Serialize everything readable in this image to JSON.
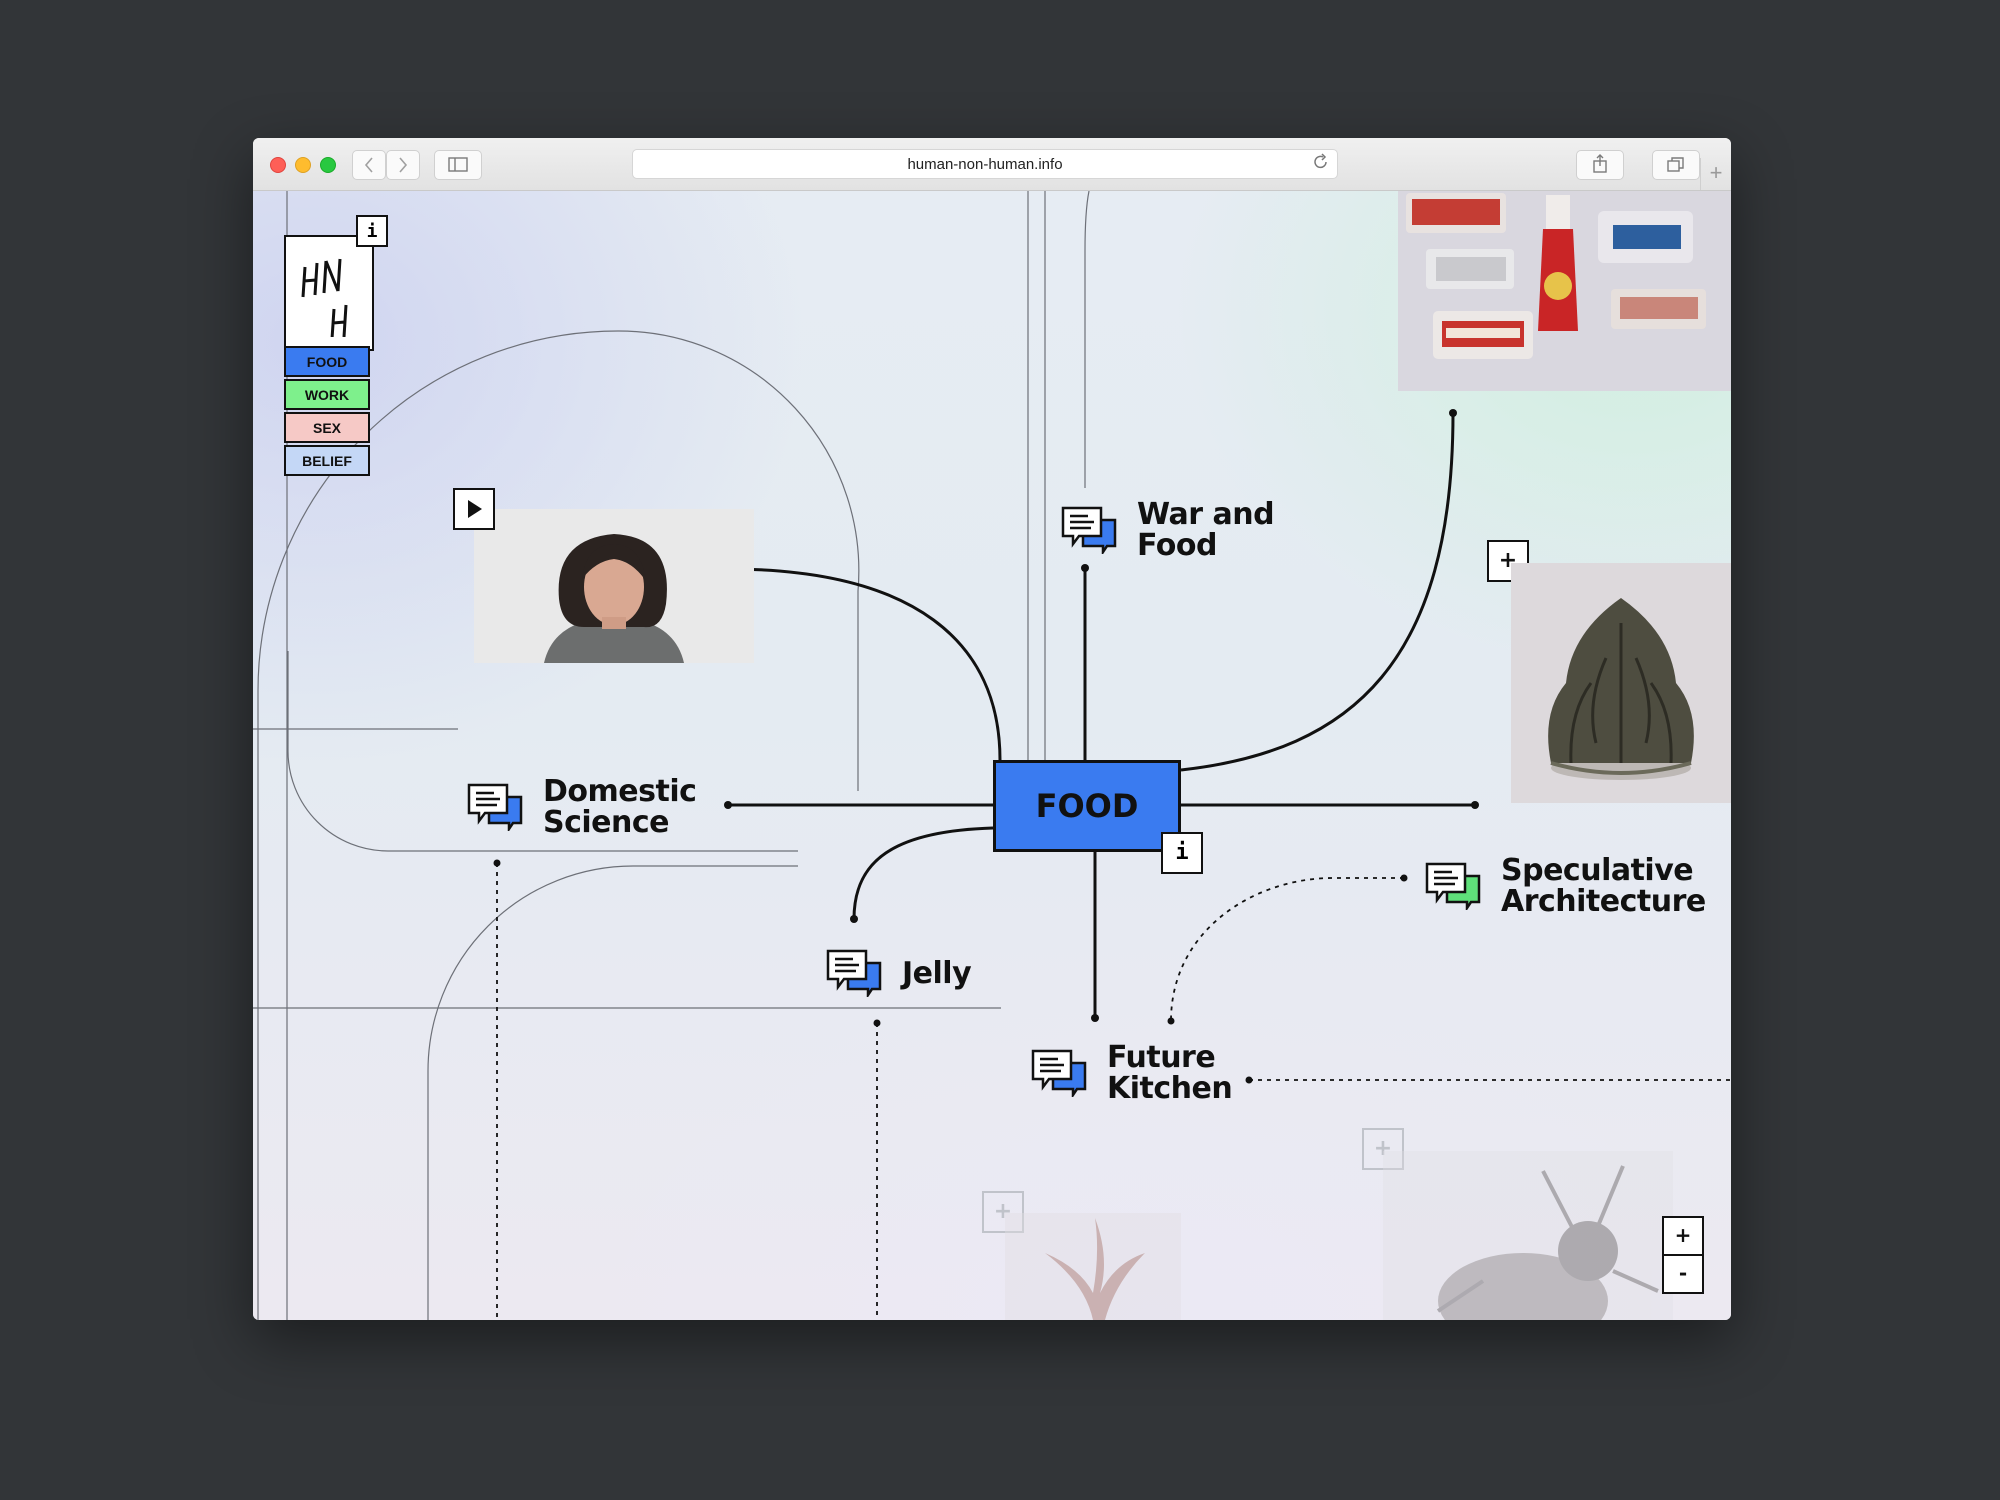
{
  "browser": {
    "url": "human-non-human.info",
    "back_icon": "chevron-left",
    "forward_icon": "chevron-right",
    "new_tab_glyph": "+"
  },
  "logo": {
    "letters": "HNH",
    "info_glyph": "i"
  },
  "categories": [
    {
      "label": "FOOD",
      "color": "#3a7bf0"
    },
    {
      "label": "WORK",
      "color": "#7ef08c"
    },
    {
      "label": "SEX",
      "color": "#f6c9c6"
    },
    {
      "label": "BELIEF",
      "color": "#c4d7f6"
    }
  ],
  "hub": {
    "label": "FOOD",
    "info_glyph": "i",
    "color": "#3a7bf0"
  },
  "nodes": [
    {
      "line1": "War and",
      "line2": "Food",
      "accent": "#3a7bf0"
    },
    {
      "line1": "Domestic",
      "line2": "Science",
      "accent": "#3a7bf0"
    },
    {
      "line1": "Jelly",
      "line2": "",
      "accent": "#3a7bf0"
    },
    {
      "line1": "Speculative",
      "line2": "Architecture",
      "accent": "#5fe07a"
    },
    {
      "line1": "Future",
      "line2": "Kitchen",
      "accent": "#3a7bf0"
    }
  ],
  "controls": {
    "expand_glyph": "+",
    "zoom_in": "+",
    "zoom_out": "-"
  }
}
